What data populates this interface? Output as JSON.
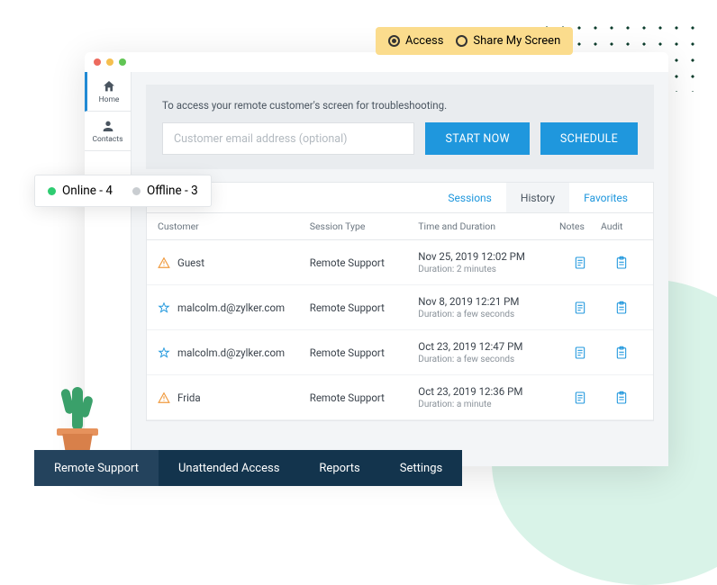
{
  "mode": {
    "access": "Access",
    "share": "Share My Screen"
  },
  "sidebar": {
    "home": "Home",
    "contacts": "Contacts"
  },
  "access_box": {
    "hint": "To access your remote customer's screen for troubleshooting.",
    "placeholder": "Customer email address (optional)",
    "start": "START NOW",
    "schedule": "SCHEDULE"
  },
  "status": {
    "online_label": "Online - 4",
    "offline_label": "Offline - 3"
  },
  "tabs": {
    "sessions": "Sessions",
    "history": "History",
    "favorites": "Favorites"
  },
  "table": {
    "headers": {
      "customer": "Customer",
      "type": "Session Type",
      "time": "Time and Duration",
      "notes": "Notes",
      "audit": "Audit"
    },
    "rows": [
      {
        "name": "Guest",
        "icon": "warn",
        "type": "Remote Support",
        "time": "Nov 25, 2019 12:02 PM",
        "duration": "Duration: 2 minutes"
      },
      {
        "name": "malcolm.d@zylker.com",
        "icon": "star",
        "type": "Remote Support",
        "time": "Nov 8, 2019 12:21 PM",
        "duration": "Duration: a few seconds"
      },
      {
        "name": "malcolm.d@zylker.com",
        "icon": "star",
        "type": "Remote Support",
        "time": "Oct 23, 2019 12:47 PM",
        "duration": "Duration: a few seconds"
      },
      {
        "name": "Frida",
        "icon": "warn",
        "type": "Remote Support",
        "time": "Oct 23, 2019 12:36 PM",
        "duration": "Duration: a minute"
      }
    ]
  },
  "bottom_nav": {
    "remote": "Remote Support",
    "unattended": "Unattended Access",
    "reports": "Reports",
    "settings": "Settings"
  }
}
